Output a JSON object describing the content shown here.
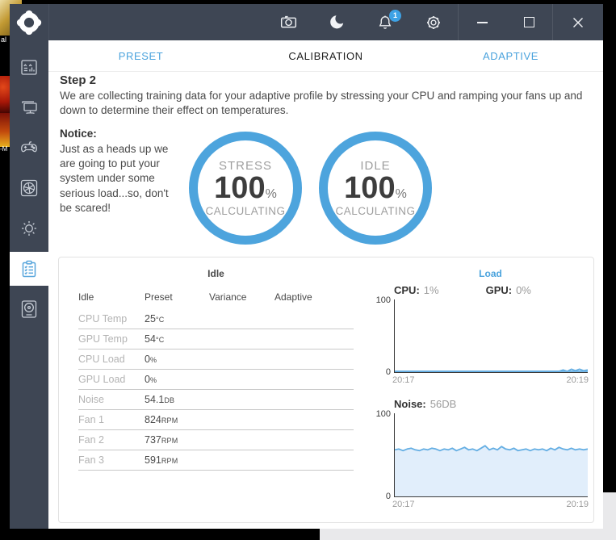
{
  "desktop": {
    "icon_labels": [
      "al",
      "-M"
    ]
  },
  "colors": {
    "titlebar": "#3e4654",
    "accent_blue": "#4ba3dd",
    "badge_blue": "#3ea2e5",
    "gauge_ring": "#4da4dd",
    "chart_line": "#64aee3",
    "chart_fill": "#e1eefb"
  },
  "titlebar": {
    "icons": [
      "camera-icon",
      "moon-icon",
      "bell-icon",
      "gear-icon"
    ],
    "notification_count": "1",
    "window_controls": [
      "minimize",
      "maximize",
      "close"
    ]
  },
  "sidebar": {
    "items": [
      {
        "icon": "monitoring-icon",
        "active": false
      },
      {
        "icon": "pc-specs-icon",
        "active": false
      },
      {
        "icon": "gamepad-icon",
        "active": false
      },
      {
        "icon": "aperture-icon",
        "active": false
      },
      {
        "icon": "sun-icon",
        "active": false
      },
      {
        "icon": "checklist-icon",
        "active": true
      },
      {
        "icon": "device-icon",
        "active": false
      }
    ]
  },
  "tabs": [
    {
      "label": "PRESET",
      "active": false
    },
    {
      "label": "CALIBRATION",
      "active": true
    },
    {
      "label": "ADAPTIVE",
      "active": false
    }
  ],
  "step": {
    "title": "Step 2",
    "description": "We are collecting training data for your adaptive profile by stressing your CPU and ramping your fans up and down to determine their effect on temperatures."
  },
  "notice": {
    "title": "Notice:",
    "body": "Just as a heads up we are going to put your system under some serious load...so, don't be scared!"
  },
  "gauges": [
    {
      "label": "STRESS",
      "value": "100",
      "unit": "%",
      "status": "CALCULATING"
    },
    {
      "label": "IDLE",
      "value": "100",
      "unit": "%",
      "status": "CALCULATING"
    }
  ],
  "idle_section": {
    "title": "Idle",
    "columns": [
      "Idle",
      "Preset",
      "Variance",
      "Adaptive"
    ],
    "rows": [
      {
        "label": "CPU Temp",
        "preset": "25",
        "unit": "°C",
        "variance": "",
        "adaptive": ""
      },
      {
        "label": "GPU Temp",
        "preset": "54",
        "unit": "°C",
        "variance": "",
        "adaptive": ""
      },
      {
        "label": "CPU Load",
        "preset": "0",
        "unit": "%",
        "variance": "",
        "adaptive": ""
      },
      {
        "label": "GPU Load",
        "preset": "0",
        "unit": "%",
        "variance": "",
        "adaptive": ""
      },
      {
        "label": "Noise",
        "preset": "54.1",
        "unit": "DB",
        "variance": "",
        "adaptive": ""
      },
      {
        "label": "Fan 1",
        "preset": "824",
        "unit": "RPM",
        "variance": "",
        "adaptive": ""
      },
      {
        "label": "Fan 2",
        "preset": "737",
        "unit": "RPM",
        "variance": "",
        "adaptive": ""
      },
      {
        "label": "Fan 3",
        "preset": "591",
        "unit": "RPM",
        "variance": "",
        "adaptive": ""
      }
    ]
  },
  "chart_data": [
    {
      "type": "line",
      "title": "Load",
      "ylim": [
        0,
        100
      ],
      "yticks": [
        "100",
        "0"
      ],
      "xticks": [
        "20:17",
        "20:19"
      ],
      "grid": false,
      "legend": "inline-top",
      "series": [
        {
          "name": "CPU",
          "label": "CPU:",
          "current": "1%",
          "values": [
            1,
            1,
            1,
            1,
            1,
            1,
            1,
            1,
            1,
            1,
            1,
            1,
            1,
            1,
            1,
            1,
            1,
            1,
            1,
            1,
            1,
            1,
            1,
            1,
            1,
            1,
            1,
            1,
            1,
            1,
            1,
            1,
            1,
            1,
            1,
            1,
            1,
            1,
            1,
            1,
            1,
            3,
            1,
            4,
            2,
            4,
            2,
            3
          ]
        },
        {
          "name": "GPU",
          "label": "GPU:",
          "current": "0%",
          "values": [
            0,
            0,
            0,
            0,
            0,
            0,
            0,
            0,
            0,
            0,
            0,
            0,
            0,
            0,
            0,
            0,
            0,
            0,
            0,
            0,
            0,
            0,
            0,
            0,
            0,
            0,
            0,
            0,
            0,
            0,
            0,
            0,
            0,
            0,
            0,
            0,
            0,
            0,
            0,
            0,
            0,
            0,
            0,
            0,
            0,
            0,
            0,
            0
          ]
        }
      ]
    },
    {
      "type": "area",
      "title": "Noise",
      "label": "Noise:",
      "current": "56DB",
      "ylim": [
        0,
        100
      ],
      "yticks": [
        "100",
        "0"
      ],
      "xticks": [
        "20:17",
        "20:19"
      ],
      "grid": false,
      "series": [
        {
          "name": "Noise",
          "values": [
            56,
            57,
            55,
            57,
            58,
            56,
            55,
            57,
            56,
            58,
            57,
            55,
            57,
            56,
            58,
            55,
            57,
            59,
            56,
            57,
            55,
            58,
            61,
            56,
            58,
            56,
            60,
            57,
            56,
            58,
            55,
            56,
            57,
            55,
            57,
            56,
            57,
            55,
            58,
            56,
            59,
            57,
            56,
            58,
            56,
            57,
            56,
            57
          ]
        }
      ]
    }
  ]
}
